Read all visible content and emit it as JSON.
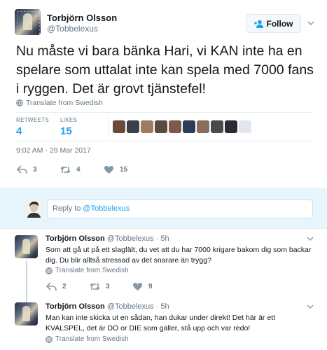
{
  "tweet": {
    "author_name": "Torbjörn Olsson",
    "author_handle": "@Tobbelexus",
    "follow_label": "Follow",
    "text": "Nu måste vi bara bänka Hari, vi KAN inte ha en spelare som uttalat inte kan spela med 7000 fans i ryggen. Det är grovt tjänstefel!",
    "translate_label": "Translate from Swedish",
    "retweets_label": "RETWEETS",
    "retweets_count": "4",
    "likes_label": "LIKES",
    "likes_count": "15",
    "timestamp": "9:02 AM - 29 Mar 2017",
    "reply_count": "3",
    "retweet_action_count": "4",
    "like_action_count": "15",
    "liker_colors": [
      "#6b4a3a",
      "#3c3f49",
      "#a07c5e",
      "#5a4a3f",
      "#7d5b4b",
      "#2e3d55",
      "#8a6d5a",
      "#4a4a4a",
      "#2b2b33",
      "#e1e8ed"
    ]
  },
  "reply_box": {
    "prefix": "Reply to ",
    "mention": "@Tobbelexus"
  },
  "replies": [
    {
      "name": "Torbjörn Olsson",
      "meta": "@Tobbelexus · 5h",
      "text": "Som att gå ut på ett slagfält, du vet att du har 7000 krigare bakom dig som backar dig. Du blir alltså stressad av det snarare än trygg?",
      "translate_label": "Translate from Swedish",
      "reply_count": "2",
      "retweet_count": "3",
      "like_count": "9"
    },
    {
      "name": "Torbjörn Olsson",
      "meta": "@Tobbelexus · 5h",
      "text": "Man kan inte skicka ut en sådan, han dukar under direkt! Det här är ett KVALSPEL, det är DO or DIE som gäller, stå upp och var redo!",
      "translate_label": "Translate from Swedish"
    }
  ],
  "colors": {
    "accent": "#1da1f2",
    "secondary_text": "#657786",
    "reply_bg": "#e8f5fd"
  }
}
